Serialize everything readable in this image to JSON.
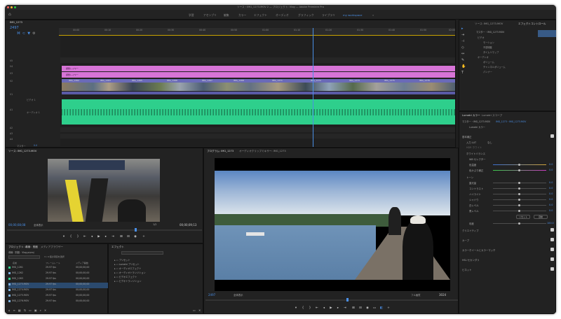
{
  "window": {
    "title": "ソース・IMG_1273.MOV 2 — プロジェクト: Vlog — Adobe Premiere Pro",
    "colors": {
      "close": "#ff5f57",
      "min": "#febc2e",
      "max": "#28c840"
    }
  },
  "workspaces": [
    "学習",
    "アセンブリ",
    "編集",
    "カラー",
    "エフェクト",
    "オーディオ",
    "グラフィック",
    "ライブラリ",
    "my workspace"
  ],
  "active_workspace": "my workspace",
  "timeline": {
    "timecode": "2497",
    "tab": "IMG_1273",
    "ruler": [
      "00:00",
      "00:10",
      "00:20",
      "00:30",
      "00:40",
      "00:50",
      "01:00",
      "01:10",
      "01:20",
      "01:30",
      "01:40",
      "01:50",
      "02:00"
    ],
    "tracks": [
      "V5",
      "V4",
      "V3",
      "V2",
      "V1",
      "A1",
      "A2",
      "A3",
      "A4"
    ],
    "v_track_labels": [
      "ビデオ 1"
    ],
    "a_track_labels": [
      "オーディオ 1"
    ],
    "pink_clip_1": "調整レイヤー",
    "pink_clip_2": "調整レイヤー",
    "clip_names": [
      "IMG_1262",
      "IMG_1263",
      "IMG_1265",
      "IMG_1266",
      "IMG_1267",
      "IMG_1268",
      "IMG_1271",
      "IMG_1272",
      "IMG_1273",
      "IMG_1275",
      "IMG_1276"
    ],
    "master_label": "マスター",
    "master_value": "0.0"
  },
  "effect_controls": {
    "tabs": [
      "ソース: IMG_1273.MOV",
      "エフェクトコントロール"
    ],
    "header": "マスター・IMG_1273.MOV",
    "seq": "IMG_1273・IMG_1273.MOV",
    "items": [
      "ビデオ",
      "モーション",
      "不透明度",
      "タイムリマップ",
      "オーディオ",
      "ボリューム",
      "チャンネルボリューム",
      "パンナー"
    ]
  },
  "lumetri": {
    "tabs": [
      "Lumetri カラー",
      "Lumetri スコープ"
    ],
    "path": "マスター・IMG_1273.MOV",
    "path2": "IMG_1273・IMG_1273.MOV",
    "effect": "Lumetri カラー",
    "sections": [
      "基本補正",
      "クリエイティブ",
      "カーブ",
      "カラーホイールとカラーマッチ",
      "HSL セカンダリ",
      "ビネット"
    ],
    "input_lut": "入力 LUT",
    "input_lut_value": "なし",
    "hdr": "HDR ホワイト",
    "wb_label": "ホワイトバランス",
    "wb_selector": "WB セレクター",
    "temp": "色温度",
    "tint": "色かぶり補正",
    "temp_value": "0.0",
    "tint_value": "0.0",
    "tone_label": "トーン",
    "tone_items": [
      "露光量",
      "コントラスト",
      "ハイライト",
      "シャドウ",
      "白レベル",
      "黒レベル"
    ],
    "tone_values": [
      "0.0",
      "0.0",
      "0.0",
      "0.0",
      "0.0",
      "0.0"
    ],
    "saturation": "彩度",
    "saturation_value": "100.0",
    "reset": "リセット",
    "auto": "自動"
  },
  "source_monitor": {
    "tab": "ソース: IMG_1273.MOV",
    "timecode": "00;00;08;08",
    "fit": "全体表示",
    "zoom": "1/2",
    "end_timecode": "00;00;09;13"
  },
  "program_monitor": {
    "tabs": [
      "プログラム: IMG_1273",
      "オーディオクリップミキサー: IMG_1273"
    ],
    "timecode": "2497",
    "fit": "全体表示",
    "quality": "フル画質",
    "end_time": "3024"
  },
  "project": {
    "tabs": [
      "プロジェクト: 導線：別館",
      "メディアブラウザー"
    ],
    "name": "導線・別館：Vlog.prproj",
    "count": "3 / 9 個の項目を選択",
    "columns": [
      "名前",
      "フレームレート",
      "メディア開始"
    ],
    "rows": [
      {
        "name": "IMG_1261",
        "fps": "29.97 fps",
        "start": "00;00;00;00",
        "color": "#7fb2e0"
      },
      {
        "name": "IMG_1262",
        "fps": "29.97 fps",
        "start": "00;00;00;00",
        "color": "#7fb2e0"
      },
      {
        "name": "IMG_1263",
        "fps": "29.97 fps",
        "start": "00;00;00;00",
        "color": "#7fb2e0"
      },
      {
        "name": "IMG_1273.MOV",
        "fps": "29.97 fps",
        "start": "00;00;00;00",
        "color": "#7fb2e0"
      },
      {
        "name": "IMG_1274.MOV",
        "fps": "29.97 fps",
        "start": "00;00;00;00",
        "color": "#7fb2e0"
      },
      {
        "name": "IMG_1275.MOV",
        "fps": "29.97 fps",
        "start": "00;00;00;00",
        "color": "#7fb2e0"
      },
      {
        "name": "IMG_1276.MOV",
        "fps": "29.97 fps",
        "start": "00;00;00;00",
        "color": "#7fb2e0"
      }
    ]
  },
  "effects": {
    "tab": "エフェクト",
    "items": [
      "プリセット",
      "Lumetri プリセット",
      "オーディオエフェクト",
      "オーディオトランジション",
      "ビデオエフェクト",
      "ビデオトランジション"
    ]
  }
}
